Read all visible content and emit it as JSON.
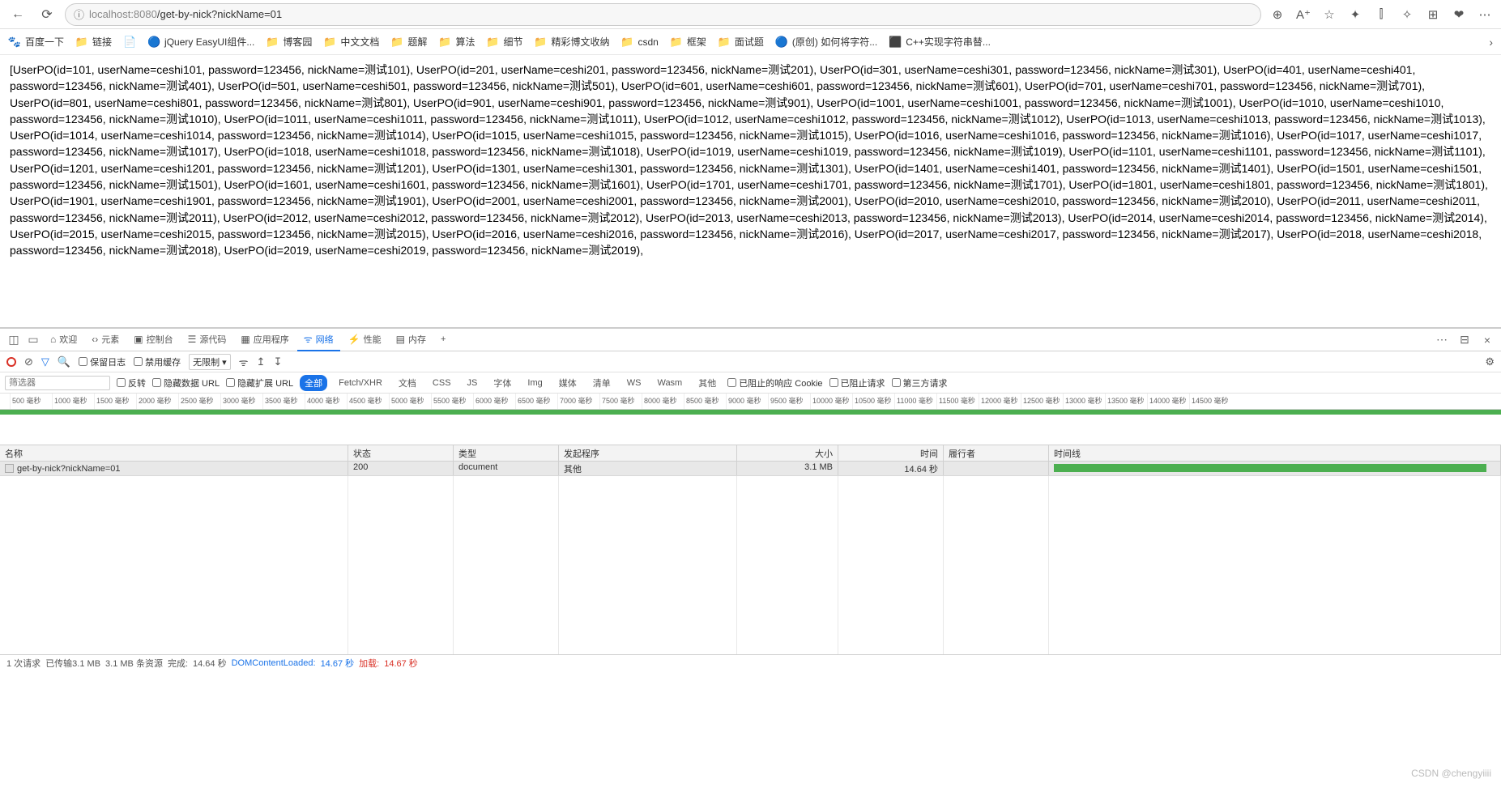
{
  "url": {
    "host": "localhost:8080",
    "path": "/get-by-nick?nickName=01"
  },
  "bookmarks": [
    {
      "icon": "🐾",
      "label": "百度一下"
    },
    {
      "icon": "📁",
      "label": "链接"
    },
    {
      "icon": "📄",
      "label": ""
    },
    {
      "icon": "🔵",
      "label": "jQuery EasyUI组件..."
    },
    {
      "icon": "📁",
      "label": "博客园"
    },
    {
      "icon": "📁",
      "label": "中文文档"
    },
    {
      "icon": "📁",
      "label": "题解"
    },
    {
      "icon": "📁",
      "label": "算法"
    },
    {
      "icon": "📁",
      "label": "细节"
    },
    {
      "icon": "📁",
      "label": "精彩博文收纳"
    },
    {
      "icon": "📁",
      "label": "csdn"
    },
    {
      "icon": "📁",
      "label": "框架"
    },
    {
      "icon": "📁",
      "label": "面试题"
    },
    {
      "icon": "🔵",
      "label": "(原创) 如何将字符..."
    },
    {
      "icon": "⬛",
      "label": "C++实现字符串替..."
    }
  ],
  "content": "[UserPO(id=101, userName=ceshi101, password=123456, nickName=测试101), UserPO(id=201, userName=ceshi201, password=123456, nickName=测试201), UserPO(id=301, userName=ceshi301, password=123456, nickName=测试301), UserPO(id=401, userName=ceshi401, password=123456, nickName=测试401), UserPO(id=501, userName=ceshi501, password=123456, nickName=测试501), UserPO(id=601, userName=ceshi601, password=123456, nickName=测试601), UserPO(id=701, userName=ceshi701, password=123456, nickName=测试701), UserPO(id=801, userName=ceshi801, password=123456, nickName=测试801), UserPO(id=901, userName=ceshi901, password=123456, nickName=测试901), UserPO(id=1001, userName=ceshi1001, password=123456, nickName=测试1001), UserPO(id=1010, userName=ceshi1010, password=123456, nickName=测试1010), UserPO(id=1011, userName=ceshi1011, password=123456, nickName=测试1011), UserPO(id=1012, userName=ceshi1012, password=123456, nickName=测试1012), UserPO(id=1013, userName=ceshi1013, password=123456, nickName=测试1013), UserPO(id=1014, userName=ceshi1014, password=123456, nickName=测试1014), UserPO(id=1015, userName=ceshi1015, password=123456, nickName=测试1015), UserPO(id=1016, userName=ceshi1016, password=123456, nickName=测试1016), UserPO(id=1017, userName=ceshi1017, password=123456, nickName=测试1017), UserPO(id=1018, userName=ceshi1018, password=123456, nickName=测试1018), UserPO(id=1019, userName=ceshi1019, password=123456, nickName=测试1019), UserPO(id=1101, userName=ceshi1101, password=123456, nickName=测试1101), UserPO(id=1201, userName=ceshi1201, password=123456, nickName=测试1201), UserPO(id=1301, userName=ceshi1301, password=123456, nickName=测试1301), UserPO(id=1401, userName=ceshi1401, password=123456, nickName=测试1401), UserPO(id=1501, userName=ceshi1501, password=123456, nickName=测试1501), UserPO(id=1601, userName=ceshi1601, password=123456, nickName=测试1601), UserPO(id=1701, userName=ceshi1701, password=123456, nickName=测试1701), UserPO(id=1801, userName=ceshi1801, password=123456, nickName=测试1801), UserPO(id=1901, userName=ceshi1901, password=123456, nickName=测试1901), UserPO(id=2001, userName=ceshi2001, password=123456, nickName=测试2001), UserPO(id=2010, userName=ceshi2010, password=123456, nickName=测试2010), UserPO(id=2011, userName=ceshi2011, password=123456, nickName=测试2011), UserPO(id=2012, userName=ceshi2012, password=123456, nickName=测试2012), UserPO(id=2013, userName=ceshi2013, password=123456, nickName=测试2013), UserPO(id=2014, userName=ceshi2014, password=123456, nickName=测试2014), UserPO(id=2015, userName=ceshi2015, password=123456, nickName=测试2015), UserPO(id=2016, userName=ceshi2016, password=123456, nickName=测试2016), UserPO(id=2017, userName=ceshi2017, password=123456, nickName=测试2017), UserPO(id=2018, userName=ceshi2018, password=123456, nickName=测试2018), UserPO(id=2019, userName=ceshi2019, password=123456, nickName=测试2019),",
  "devtools": {
    "tabs": {
      "welcome": "欢迎",
      "elements": "元素",
      "console": "控制台",
      "sources": "源代码",
      "application": "应用程序",
      "network": "网络",
      "performance": "性能",
      "memory": "内存"
    },
    "toolbar": {
      "preserve": "保留日志",
      "disable_cache": "禁用缓存",
      "throttle": "无限制"
    },
    "filter": {
      "placeholder": "筛选器",
      "invert": "反转",
      "hide_data": "隐藏数据 URL",
      "hide_ext": "隐藏扩展 URL",
      "types": {
        "all": "全部",
        "fetch": "Fetch/XHR",
        "doc": "文档",
        "css": "CSS",
        "js": "JS",
        "font": "字体",
        "img": "Img",
        "media": "媒体",
        "manifest": "清单",
        "ws": "WS",
        "wasm": "Wasm",
        "other": "其他"
      },
      "blocked_cookies": "已阻止的响应 Cookie",
      "blocked_req": "已阻止请求",
      "third_party": "第三方请求"
    },
    "timeline_labels": [
      "500 毫秒",
      "1000 毫秒",
      "1500 毫秒",
      "2000 毫秒",
      "2500 毫秒",
      "3000 毫秒",
      "3500 毫秒",
      "4000 毫秒",
      "4500 毫秒",
      "5000 毫秒",
      "5500 毫秒",
      "6000 毫秒",
      "6500 毫秒",
      "7000 毫秒",
      "7500 毫秒",
      "8000 毫秒",
      "8500 毫秒",
      "9000 毫秒",
      "9500 毫秒",
      "10000 毫秒",
      "10500 毫秒",
      "11000 毫秒",
      "11500 毫秒",
      "12000 毫秒",
      "12500 毫秒",
      "13000 毫秒",
      "13500 毫秒",
      "14000 毫秒",
      "14500 毫秒"
    ],
    "columns": {
      "name": "名称",
      "status": "状态",
      "type": "类型",
      "initiator": "发起程序",
      "size": "大小",
      "time": "时间",
      "fulfilled": "履行者",
      "waterfall": "时间线"
    },
    "row": {
      "name": "get-by-nick?nickName=01",
      "status": "200",
      "type": "document",
      "initiator": "其他",
      "size": "3.1 MB",
      "time": "14.64 秒"
    },
    "status": {
      "requests": "1 次请求",
      "transferred": "已传输3.1 MB",
      "resources": "3.1 MB 条资源",
      "finish_label": "完成:",
      "finish": "14.64 秒",
      "dcl_label": "DOMContentLoaded:",
      "dcl": "14.67 秒",
      "load_label": "加载:",
      "load": "14.67 秒"
    }
  },
  "watermark": "CSDN @chengyiiii"
}
